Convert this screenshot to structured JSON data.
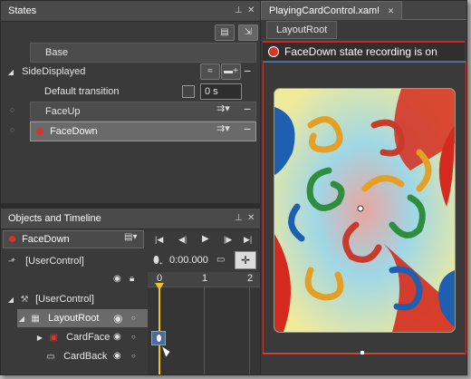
{
  "states_panel": {
    "title": "States",
    "base_label": "Base",
    "group_label": "SideDisplayed",
    "default_transition_label": "Default transition",
    "default_transition_value": "0 s",
    "states": [
      {
        "label": "FaceUp"
      },
      {
        "label": "FaceDown"
      }
    ]
  },
  "timeline_panel": {
    "title": "Objects and Timeline",
    "current_state": "FaceDown",
    "time_value": "0:00.000",
    "root_label": "[UserControl]",
    "tree_root": "[UserControl]",
    "tree_items": [
      {
        "label": "LayoutRoot"
      },
      {
        "label": "CardFace"
      },
      {
        "label": "CardBack"
      }
    ],
    "ruler_ticks": [
      "0",
      "1",
      "2"
    ]
  },
  "document": {
    "tab_label": "PlayingCardControl.xaml",
    "breadcrumb": "LayoutRoot",
    "recording_text": "FaceDown state recording is on"
  },
  "colors": {
    "record_red": "#d9342b",
    "panel_bg": "#3a3a3a",
    "selection": "#6a6a6a"
  }
}
